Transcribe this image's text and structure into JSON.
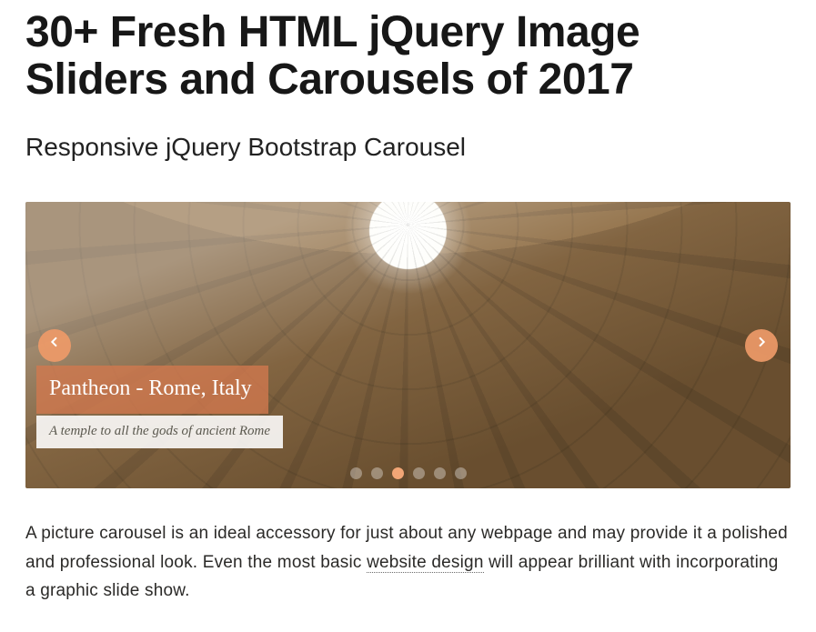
{
  "header": {
    "title": "30+ Fresh HTML jQuery Image Sliders and Carousels of 2017",
    "subtitle": "Responsive jQuery Bootstrap Carousel"
  },
  "carousel": {
    "caption_title": "Pantheon - Rome, Italy",
    "caption_sub": "A temple to all the gods of ancient Rome",
    "dot_count": 6,
    "active_dot_index": 2
  },
  "body": {
    "p1_a": "A picture carousel is an ideal accessory for just about any webpage and may provide it a polished and professional look. Even the most basic ",
    "link_text": "website design",
    "p1_b": " will appear brilliant with incorporating a graphic slide show."
  }
}
